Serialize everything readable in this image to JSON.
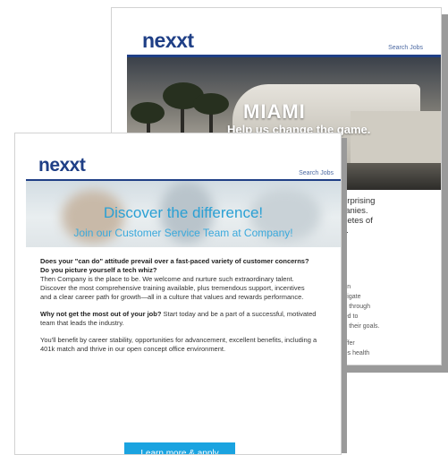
{
  "back_email": {
    "logo": "nexxt",
    "search_link": "Search Jobs",
    "hero_title": "MIAMI",
    "hero_subtitle": "Help us change the game.",
    "body_fragments": [
      "t surprising",
      "mpanies.",
      "athletes of",
      "cial."
    ],
    "body_fragments_2": [
      "ation",
      "navigate",
      "tion through",
      "need to",
      "eve their goals.",
      "",
      "e offer",
      "ages health"
    ]
  },
  "front_email": {
    "logo": "nexxt",
    "search_link": "Search Jobs",
    "hero_heading": "Discover the difference!",
    "hero_subheading": "Join our Customer Service Team at Company!",
    "p1_bold": "Does your \"can do\" attitude prevail over a fast-paced variety of customer concerns? Do you picture yourself a tech whiz?",
    "p1_text": "Then Company is the place to be. We welcome and nurture such extraordinary talent. Discover the most comprehensive training available, plus tremendous support, incentives and a clear career path for growth—all in a culture that values and rewards performance.",
    "p2_bold": "Why not get the most out of your job?",
    "p2_text": " Start today and be a part of a successful, motivated team that leads the industry.",
    "p3_text": "You'll benefit by career stability, opportunities for advancement, excellent benefits, including a 401k match and thrive in our open concept office environment.",
    "cta_label": "Learn more & apply"
  },
  "colors": {
    "brand_navy": "#1f3f86",
    "accent_blue": "#1aa3e0"
  }
}
